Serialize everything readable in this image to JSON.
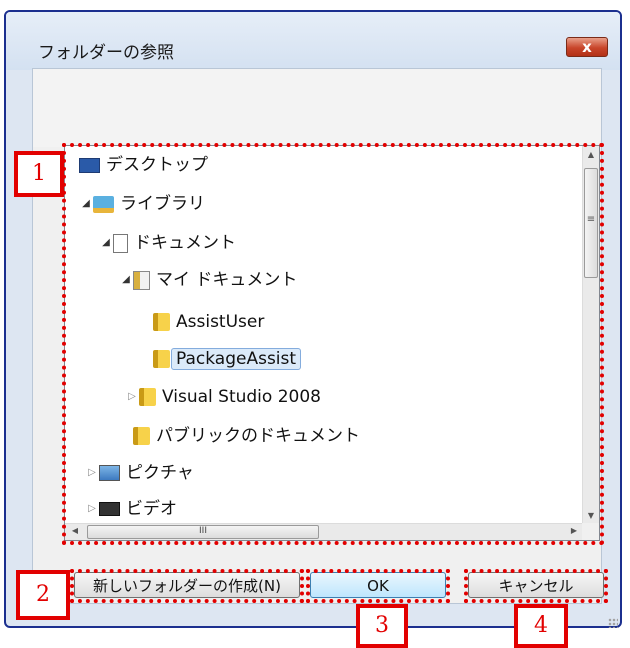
{
  "dialog": {
    "title": "フォルダーの参照",
    "close_glyph": "x"
  },
  "tree": {
    "items": [
      {
        "label": "デスクトップ",
        "icon": "desktop-icon",
        "state": "none"
      },
      {
        "label": "ライブラリ",
        "icon": "library-icon",
        "state": "expanded"
      },
      {
        "label": "ドキュメント",
        "icon": "document-icon",
        "state": "expanded"
      },
      {
        "label": "マイ ドキュメント",
        "icon": "my-documents-icon",
        "state": "expanded"
      },
      {
        "label": "AssistUser",
        "icon": "folder-icon",
        "state": "none"
      },
      {
        "label": "PackageAssist",
        "icon": "folder-icon",
        "state": "none",
        "selected": true
      },
      {
        "label": "Visual Studio 2008",
        "icon": "folder-icon",
        "state": "collapsed"
      },
      {
        "label": "パブリックのドキュメント",
        "icon": "folder-icon",
        "state": "none"
      },
      {
        "label": "ピクチャ",
        "icon": "pictures-icon",
        "state": "collapsed"
      },
      {
        "label": "ビデオ",
        "icon": "videos-icon",
        "state": "collapsed"
      }
    ],
    "expanded_glyph": "◢",
    "collapsed_glyph": "▷",
    "scroll_up_glyph": "▲",
    "scroll_down_glyph": "▼",
    "scroll_left_glyph": "◀",
    "scroll_right_glyph": "▶",
    "hthumb_grip": "III",
    "vthumb_grip": "≡"
  },
  "buttons": {
    "new_folder": "新しいフォルダーの作成(N)",
    "ok": "OK",
    "cancel": "キャンセル"
  },
  "annotations": {
    "label_1": "1",
    "label_2": "2",
    "label_3": "3",
    "label_4": "4",
    "color": "#e20000"
  }
}
